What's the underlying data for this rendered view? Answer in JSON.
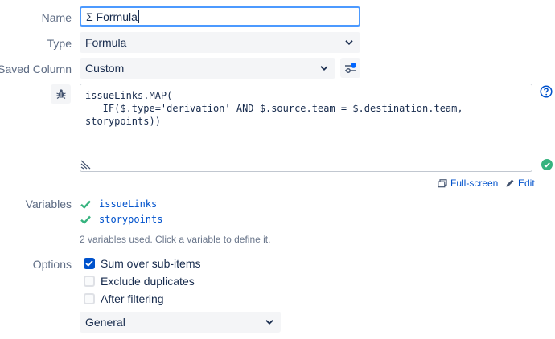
{
  "labels": {
    "name": "Name",
    "type": "Type",
    "saved_column": "Saved Column",
    "variables": "Variables",
    "options": "Options"
  },
  "name_field": {
    "value": "Σ Formula"
  },
  "type_select": {
    "value": "Formula"
  },
  "saved_column_select": {
    "value": "Custom"
  },
  "formula": {
    "line1": "issueLinks.MAP(",
    "line2": "   IF($.type='derivation' AND $.source.team = $.destination.team,",
    "line3": "storypoints))"
  },
  "actions": {
    "fullscreen": "Full-screen",
    "edit": "Edit"
  },
  "variables": {
    "items": [
      "issueLinks",
      "storypoints"
    ],
    "hint": "2 variables used. Click a variable to define it."
  },
  "options": {
    "sum_over_subitems": {
      "label": "Sum over sub-items",
      "checked": true
    },
    "exclude_duplicates": {
      "label": "Exclude duplicates",
      "checked": false
    },
    "after_filtering": {
      "label": "After filtering",
      "checked": false
    },
    "format_select": "General"
  },
  "colors": {
    "accent": "#0052cc",
    "focus": "#4c9aff",
    "success": "#36b37e",
    "field_bg": "#f4f5f7"
  }
}
